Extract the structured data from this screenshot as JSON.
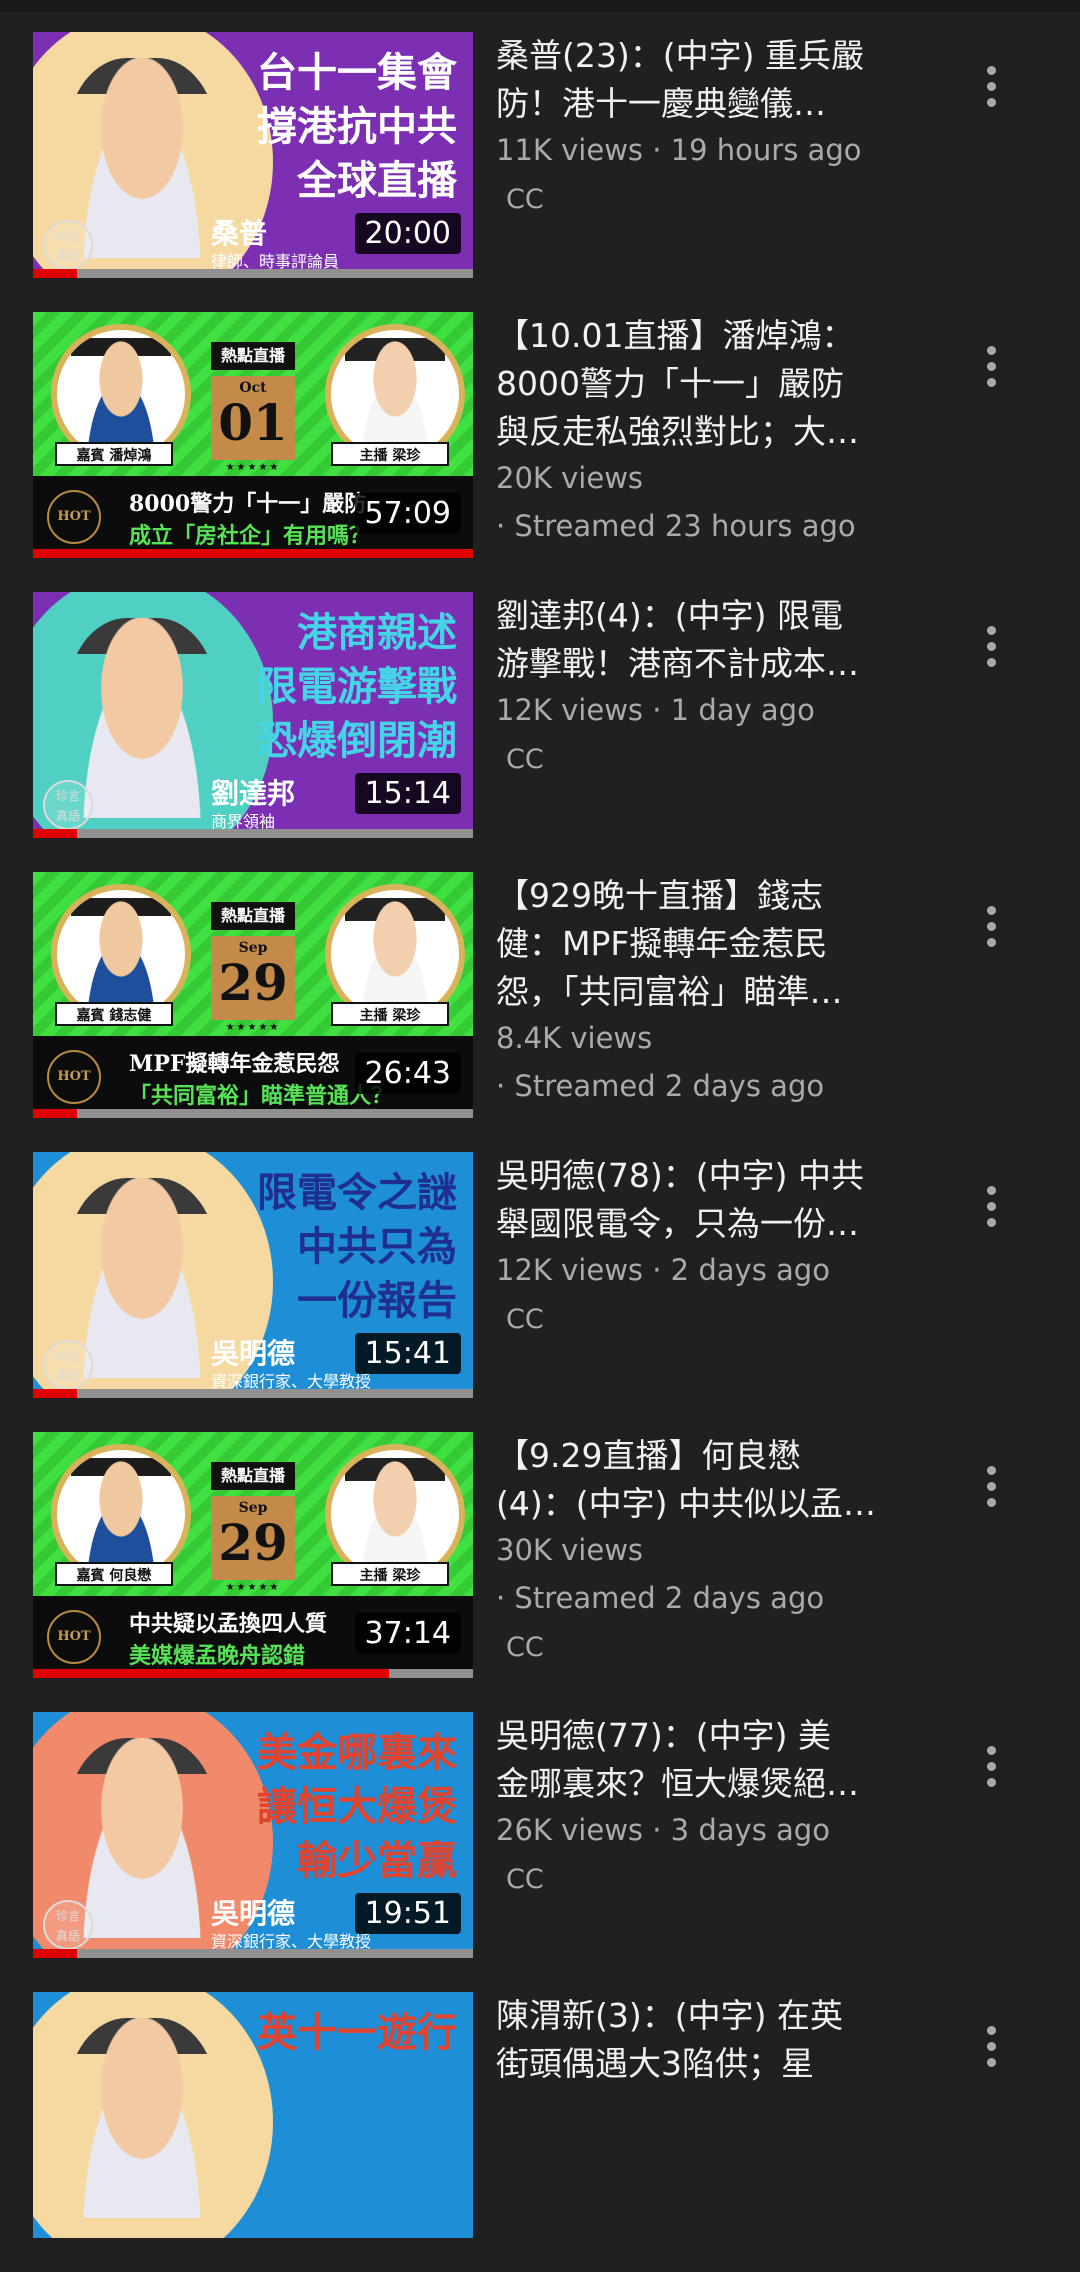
{
  "videos": [
    {
      "kind": "portrait",
      "accent": "#ffffff",
      "panel_color": "#7d2fb3",
      "circle_color": "#f6d9a0",
      "headline": "台十一集會\n撐港抗中共\n全球直播",
      "name_caption": "桑普",
      "sub_caption": "律師、時事評論員",
      "seal": "珍言\n真語",
      "duration": "20:00",
      "progress": 0.1,
      "title": "桑普(23)：(中字) 重兵嚴\n防！港十一慶典變儀…",
      "views": "11K views · 19 hours ago",
      "badge": "CC"
    },
    {
      "kind": "live",
      "guest_tag": "嘉賓 潘焯鴻",
      "host_tag": "主播 梁珍",
      "live_label": "熱點直播",
      "month": "Oct",
      "day": "01",
      "stars": "★★★★★",
      "hot": "HOT",
      "banner_line1": "8000警力「十一」嚴防",
      "banner_line2": "成立「房社企」有用嗎？",
      "duration": "57:09",
      "progress": 1.0,
      "title": "【10.01直播】潘焯鴻：\n8000警力「十一」嚴防\n與反走私強烈對比；大…",
      "views": "20K views",
      "streamed": "· Streamed 23 hours ago"
    },
    {
      "kind": "portrait",
      "accent": "#45d4e6",
      "panel_color": "#7d2fb3",
      "circle_color": "#4fd0c2",
      "headline": "港商親述\n限電游擊戰\n恐爆倒閉潮",
      "name_caption": "劉達邦",
      "sub_caption": "商界領袖",
      "seal": "珍言\n真語",
      "duration": "15:14",
      "progress": 0.1,
      "title": "劉達邦(4)：(中字) 限電\n游擊戰！港商不計成本…",
      "views": "12K views · 1 day ago",
      "badge": "CC"
    },
    {
      "kind": "live",
      "guest_tag": "嘉賓 錢志健",
      "host_tag": "主播 梁珍",
      "live_label": "熱點直播",
      "month": "Sep",
      "day": "29",
      "stars": "★★★★★",
      "hot": "HOT",
      "banner_line1": "MPF擬轉年金惹民怨",
      "banner_line2": "「共同富裕」瞄準普通人？",
      "duration": "26:43",
      "progress": 0.1,
      "title": "【929晚十直播】錢志\n健：MPF擬轉年金惹民\n怨，「共同富裕」瞄準…",
      "views": "8.4K views",
      "streamed": "· Streamed 2 days ago"
    },
    {
      "kind": "portrait",
      "accent": "#1f2f8f",
      "panel_color": "#1e8fd6",
      "circle_color": "#f6d9a0",
      "headline": "限電令之謎\n中共只為\n一份報告",
      "name_caption": "吳明德",
      "sub_caption": "資深銀行家、大學教授",
      "seal": "珍言\n真語",
      "duration": "15:41",
      "progress": 0.1,
      "title": "吳明德(78)：(中字) 中共\n舉國限電令，只為一份…",
      "views": "12K views · 2 days ago",
      "badge": "CC"
    },
    {
      "kind": "live",
      "guest_tag": "嘉賓 何良懋",
      "host_tag": "主播 梁珍",
      "live_label": "熱點直播",
      "month": "Sep",
      "day": "29",
      "stars": "★★★★★",
      "hot": "HOT",
      "banner_line1": "中共疑以孟換四人質",
      "banner_line2": "美媒爆孟晚舟認錯",
      "duration": "37:14",
      "progress": 0.81,
      "title": "【9.29直播】何良懋\n(4)：(中字) 中共似以孟…",
      "views": "30K views",
      "streamed": "· Streamed 2 days ago",
      "badge": "CC"
    },
    {
      "kind": "portrait",
      "accent": "#e0432e",
      "panel_color": "#1e8fd6",
      "circle_color": "#f08a6a",
      "headline": "美金哪裏來\n讓恒大爆煲\n輸少當贏",
      "name_caption": "吳明德",
      "sub_caption": "資深銀行家、大學教授",
      "seal": "珍言\n真語",
      "duration": "19:51",
      "progress": 0.1,
      "title": "吳明德(77)：(中字) 美\n金哪裏來？恒大爆煲絕…",
      "views": "26K views · 3 days ago",
      "badge": "CC"
    },
    {
      "kind": "portrait",
      "accent": "#e0432e",
      "panel_color": "#1e8fd6",
      "circle_color": "#f6d9a0",
      "headline": "英十一遊行",
      "name_caption": "",
      "sub_caption": "",
      "seal": "",
      "duration": "",
      "progress": 0,
      "title": "陳渭新(3)：(中字) 在英\n街頭偶遇大3陷供；星"
    }
  ]
}
